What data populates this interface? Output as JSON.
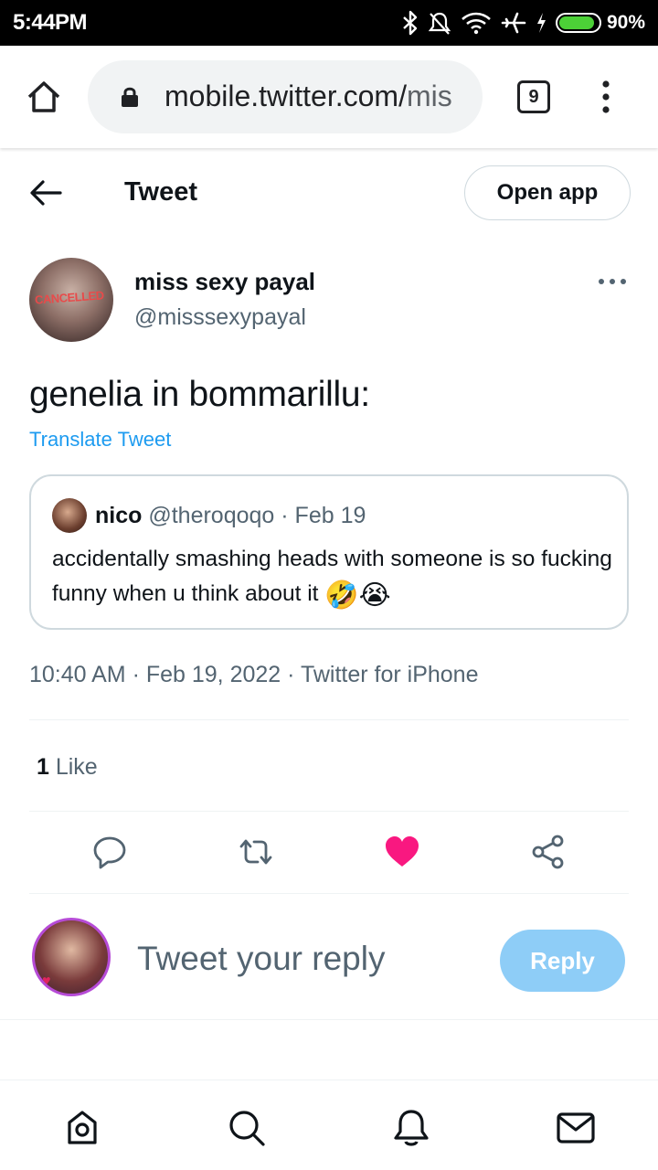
{
  "status_bar": {
    "time": "5:44PM",
    "battery_percent": "90%",
    "battery_level": 0.9,
    "icons": [
      "bluetooth-icon",
      "alarm-off-icon",
      "wifi-icon",
      "airplane-icon",
      "charging-icon",
      "battery-icon"
    ]
  },
  "browser": {
    "url_host": "mobile.twitter.com/",
    "url_rest": "mis",
    "tab_count": "9",
    "icons": [
      "home-icon",
      "lock-icon",
      "overflow-menu-icon"
    ]
  },
  "header": {
    "title": "Tweet",
    "open_app_label": "Open app",
    "back_icon": "back-arrow-icon"
  },
  "tweet": {
    "author_name": "miss sexy payal",
    "author_handle": "@misssexypayal",
    "avatar_stamp": "CANCELLED",
    "text": "genelia in bommarillu:",
    "translate_label": "Translate Tweet",
    "timestamp": "10:40 AM · Feb 19, 2022 · Twitter for iPhone",
    "like_count": "1",
    "like_label": " Like",
    "quote": {
      "name": "nico",
      "meta": " @theroqoqo · Feb 19",
      "text": "accidentally smashing heads with someone is so fucking funny when u think about it ",
      "emojis": "🤣😭"
    }
  },
  "actions": [
    "reply-icon",
    "retweet-icon",
    "like-icon",
    "share-icon"
  ],
  "reply_box": {
    "placeholder": "Tweet your reply",
    "button_label": "Reply"
  },
  "bottom_nav": [
    "home-icon",
    "search-icon",
    "notifications-icon",
    "messages-icon"
  ],
  "colors": {
    "accent": "#1d9bf0",
    "like": "#f91880",
    "reply_button": "#8ecdf7",
    "secondary_text": "#536471"
  }
}
